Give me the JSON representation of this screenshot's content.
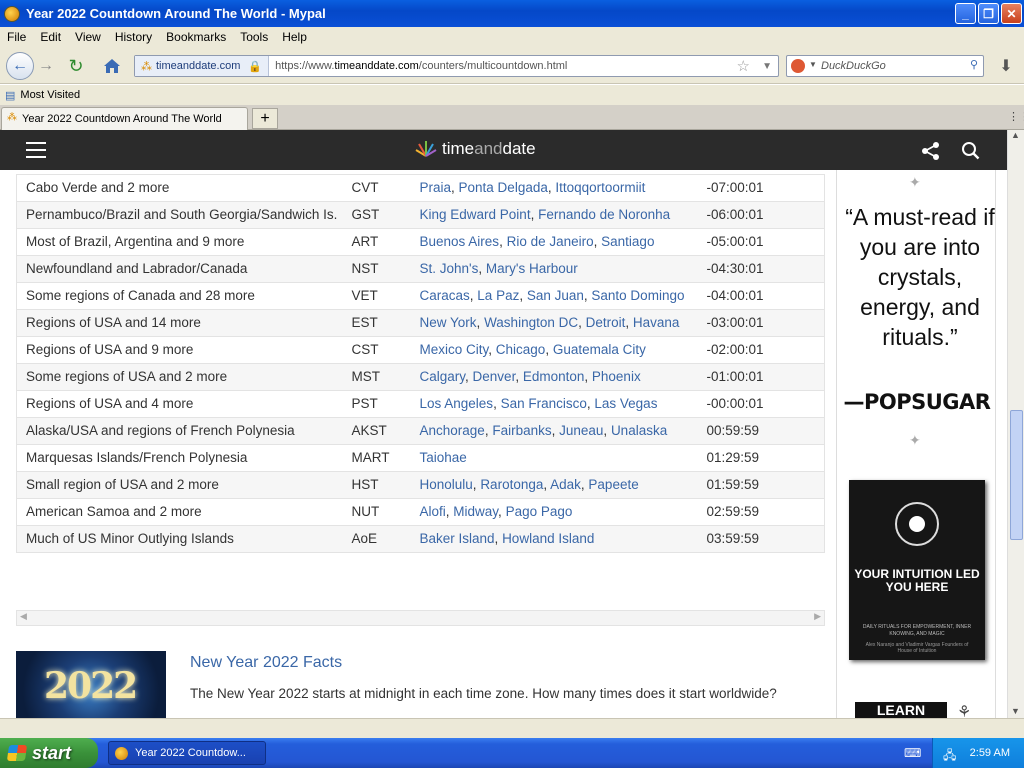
{
  "window": {
    "title": "Year 2022 Countdown Around The World - Mypal"
  },
  "menu": [
    "File",
    "Edit",
    "View",
    "History",
    "Bookmarks",
    "Tools",
    "Help"
  ],
  "nav": {
    "site_label": "timeanddate.com",
    "url_prefix": "https://www.",
    "url_domain": "timeanddate.com",
    "url_path": "/counters/multicountdown.html",
    "search_placeholder": "DuckDuckGo"
  },
  "bookmarks": {
    "most_visited": "Most Visited"
  },
  "tab": {
    "label": "Year 2022 Countdown Around The World",
    "new_tab": "+"
  },
  "site": {
    "logo_pre": "time",
    "logo_and": "and",
    "logo_post": "date"
  },
  "table": {
    "rows": [
      {
        "region": "Cabo Verde and 2 more",
        "abbr": "CVT",
        "cities": [
          "Praia",
          "Ponta Delgada",
          "Ittoqqortoormiit"
        ],
        "offset": "-07:00:01"
      },
      {
        "region": "Pernambuco/Brazil and South Georgia/Sandwich Is.",
        "abbr": "GST",
        "cities": [
          "King Edward Point",
          "Fernando de Noronha"
        ],
        "offset": "-06:00:01"
      },
      {
        "region": "Most of Brazil, Argentina and 9 more",
        "abbr": "ART",
        "cities": [
          "Buenos Aires",
          "Rio de Janeiro",
          "Santiago"
        ],
        "offset": "-05:00:01"
      },
      {
        "region": "Newfoundland and Labrador/Canada",
        "abbr": "NST",
        "cities": [
          "St. John's",
          "Mary's Harbour"
        ],
        "offset": "-04:30:01"
      },
      {
        "region": "Some regions of Canada and 28 more",
        "abbr": "VET",
        "cities": [
          "Caracas",
          "La Paz",
          "San Juan",
          "Santo Domingo"
        ],
        "offset": "-04:00:01"
      },
      {
        "region": "Regions of USA and 14 more",
        "abbr": "EST",
        "cities": [
          "New York",
          "Washington DC",
          "Detroit",
          "Havana"
        ],
        "offset": "-03:00:01"
      },
      {
        "region": "Regions of USA and 9 more",
        "abbr": "CST",
        "cities": [
          "Mexico City",
          "Chicago",
          "Guatemala City"
        ],
        "offset": "-02:00:01"
      },
      {
        "region": "Some regions of USA and 2 more",
        "abbr": "MST",
        "cities": [
          "Calgary",
          "Denver",
          "Edmonton",
          "Phoenix"
        ],
        "offset": "-01:00:01"
      },
      {
        "region": "Regions of USA and 4 more",
        "abbr": "PST",
        "cities": [
          "Los Angeles",
          "San Francisco",
          "Las Vegas"
        ],
        "offset": "-00:00:01"
      },
      {
        "region": "Alaska/USA and regions of French Polynesia",
        "abbr": "AKST",
        "cities": [
          "Anchorage",
          "Fairbanks",
          "Juneau",
          "Unalaska"
        ],
        "offset": "00:59:59"
      },
      {
        "region": "Marquesas Islands/French Polynesia",
        "abbr": "MART",
        "cities": [
          "Taiohae"
        ],
        "offset": "01:29:59"
      },
      {
        "region": "Small region of USA and 2 more",
        "abbr": "HST",
        "cities": [
          "Honolulu",
          "Rarotonga",
          "Adak",
          "Papeete"
        ],
        "offset": "01:59:59"
      },
      {
        "region": "American Samoa and 2 more",
        "abbr": "NUT",
        "cities": [
          "Alofi",
          "Midway",
          "Pago Pago"
        ],
        "offset": "02:59:59"
      },
      {
        "region": "Much of US Minor Outlying Islands",
        "abbr": "AoE",
        "cities": [
          "Baker Island",
          "Howland Island"
        ],
        "offset": "03:59:59"
      }
    ]
  },
  "facts": {
    "image_text": "2022",
    "title": "New Year 2022 Facts",
    "text": "The New Year 2022 starts at midnight in each time zone. How many times does it start worldwide?"
  },
  "ad": {
    "quote": "“A must-read if you are into crystals, energy, and rituals.”",
    "source": "—POPSUGAR",
    "book_title": "YOUR INTUITION LED YOU HERE",
    "book_subtitle": "DAILY RITUALS FOR EMPOWERMENT, INNER KNOWING, AND MAGIC",
    "book_authors": "Alex Naranjo and Vladimir Vargas Founders of House of Intuition",
    "cta": "LEARN MORE"
  },
  "taskbar": {
    "start": "start",
    "task": "Year 2022 Countdow...",
    "clock": "2:59 AM"
  }
}
